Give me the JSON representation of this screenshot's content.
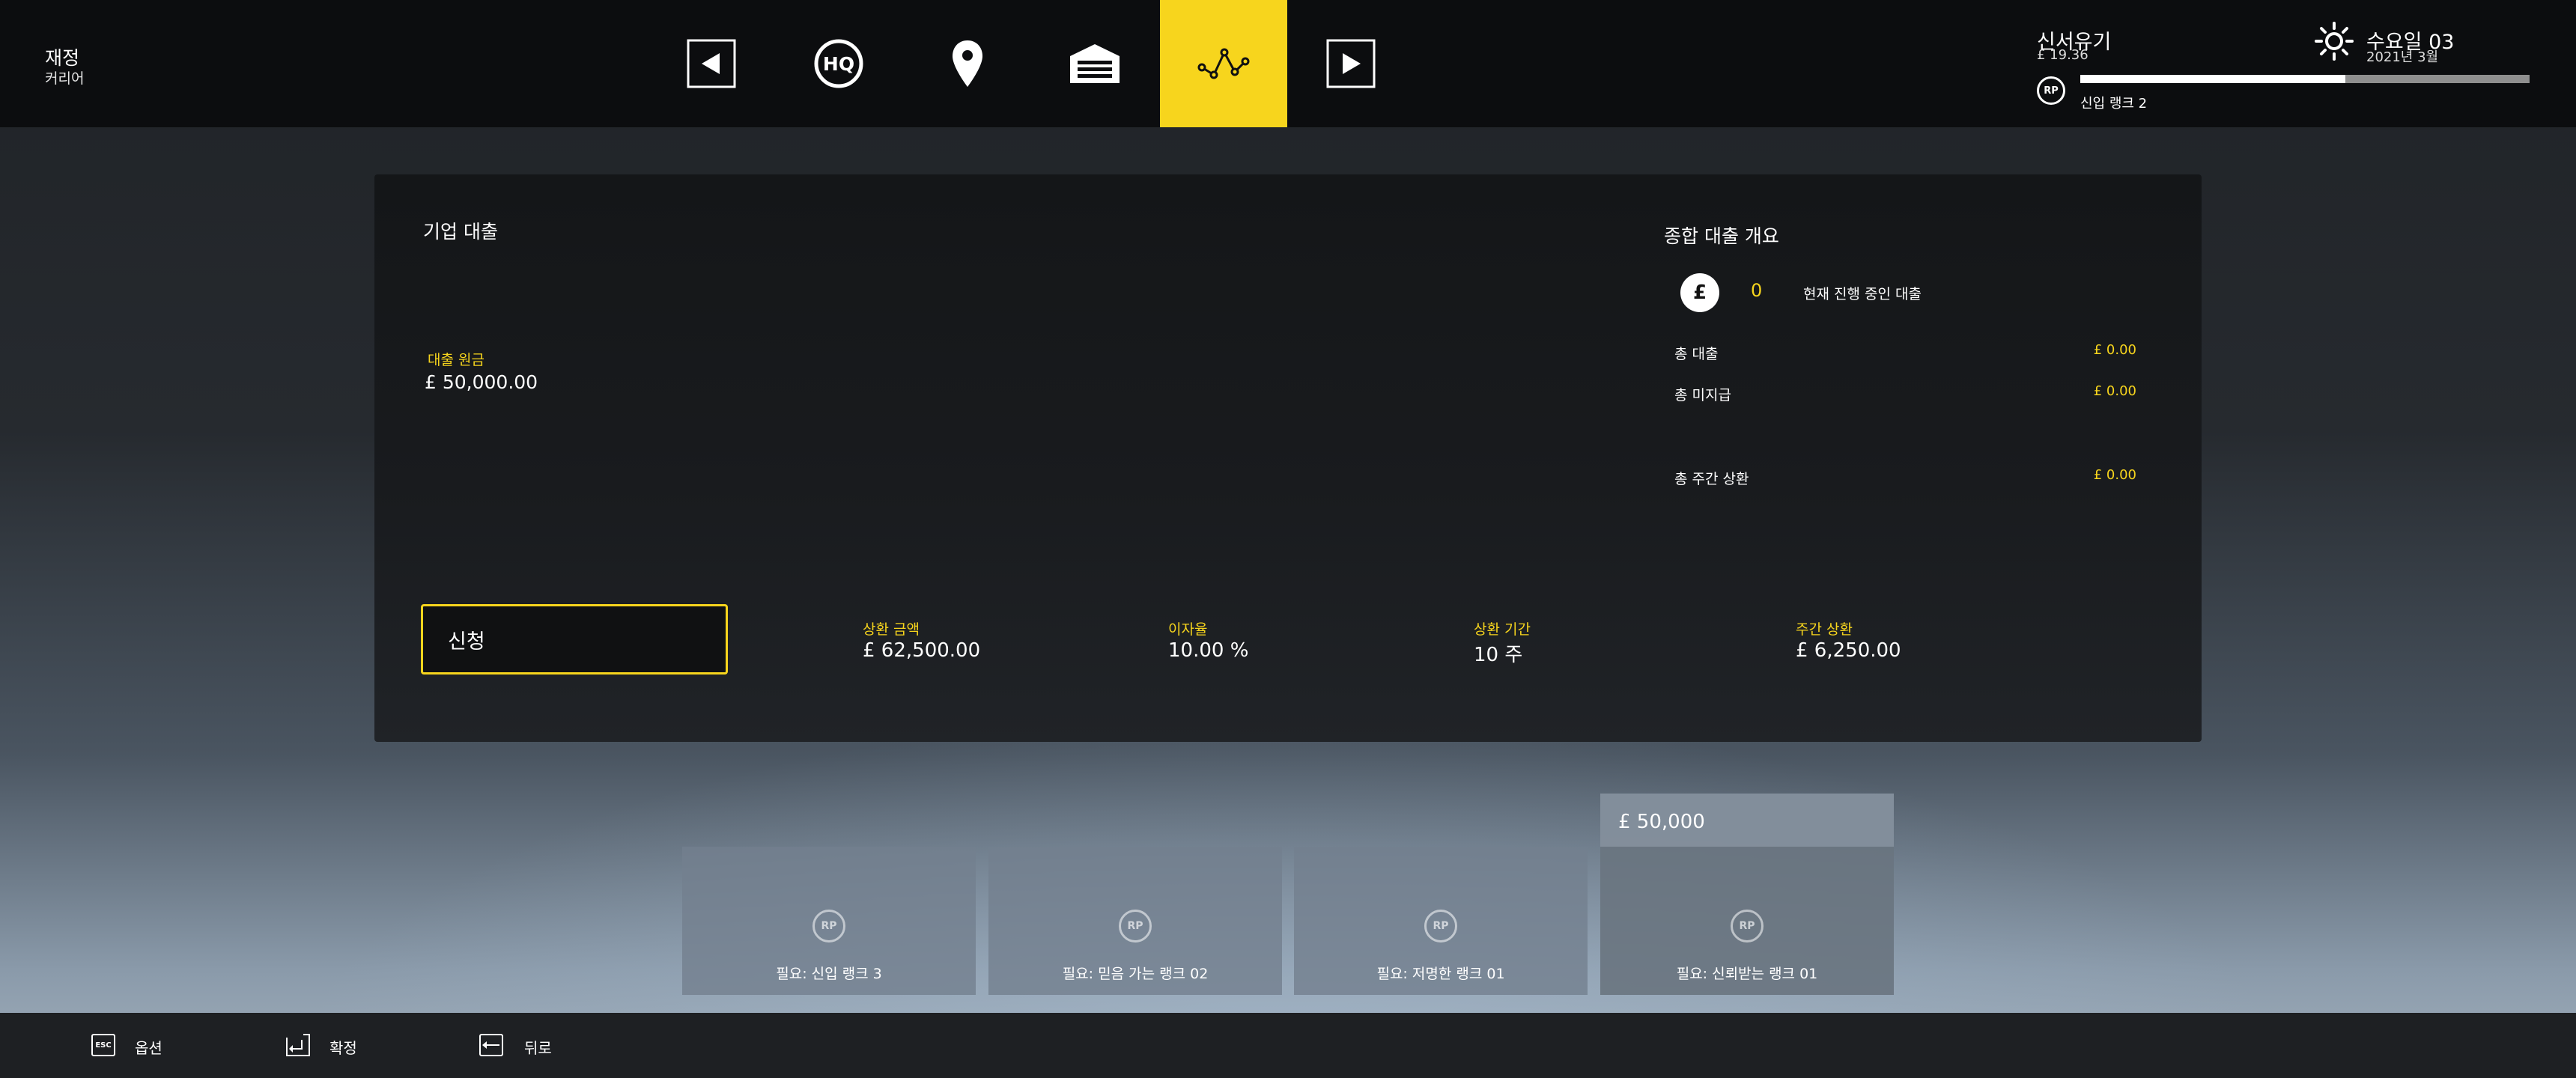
{
  "header": {
    "section_title": "재정",
    "section_subtitle": "커리어",
    "nav": [
      {
        "name": "prev-arrow-icon"
      },
      {
        "name": "hq-icon",
        "label": "HQ"
      },
      {
        "name": "map-pin-icon"
      },
      {
        "name": "garage-icon"
      },
      {
        "name": "finance-chart-icon",
        "active": true
      },
      {
        "name": "next-arrow-icon"
      }
    ],
    "career_label": "신서유기",
    "money": "£ 19.36",
    "rp_badge": "RP",
    "rank_label": "신입 랭크 2",
    "rank_progress": 0.59,
    "weather_icon": "sun-icon",
    "day_label": "수요일 03",
    "date_label": "2021년 3월"
  },
  "loan": {
    "title": "기업 대출",
    "principal_label": "대출 원금",
    "principal_value": "£ 50,000.00",
    "apply_label": "신청",
    "stats": [
      {
        "label": "상환 금액",
        "value": "£ 62,500.00"
      },
      {
        "label": "이자율",
        "value": "10.00 %"
      },
      {
        "label": "상환 기간",
        "value": "10 주"
      },
      {
        "label": "주간 상환",
        "value": "£ 6,250.00"
      }
    ]
  },
  "overview": {
    "title": "종합 대출 개요",
    "icon": "£",
    "active_count": "0",
    "active_label": "현재 진행 중인 대출",
    "rows": [
      {
        "label": "총 대출",
        "value": "£ 0.00"
      },
      {
        "label": "총 미지급",
        "value": "£ 0.00"
      },
      {
        "label": "총 주간 상환",
        "value": "£ 0.00"
      }
    ]
  },
  "cards": [
    {
      "rp": "RP",
      "requirement": "필요: 신입 랭크 3"
    },
    {
      "rp": "RP",
      "requirement": "필요: 믿음 가는 랭크 02"
    },
    {
      "rp": "RP",
      "requirement": "필요: 저명한 랭크 01"
    },
    {
      "rp": "RP",
      "requirement": "필요: 신뢰받는 랭크 01",
      "amount": "£ 50,000"
    }
  ],
  "footer": [
    {
      "key": "ESC",
      "label": "옵션"
    },
    {
      "key": "",
      "label": "확정"
    },
    {
      "key": "",
      "label": "뒤로"
    }
  ],
  "colors": {
    "accent": "#f7d51d",
    "topbar": "#0c0d0f",
    "panel": "#17191b"
  }
}
